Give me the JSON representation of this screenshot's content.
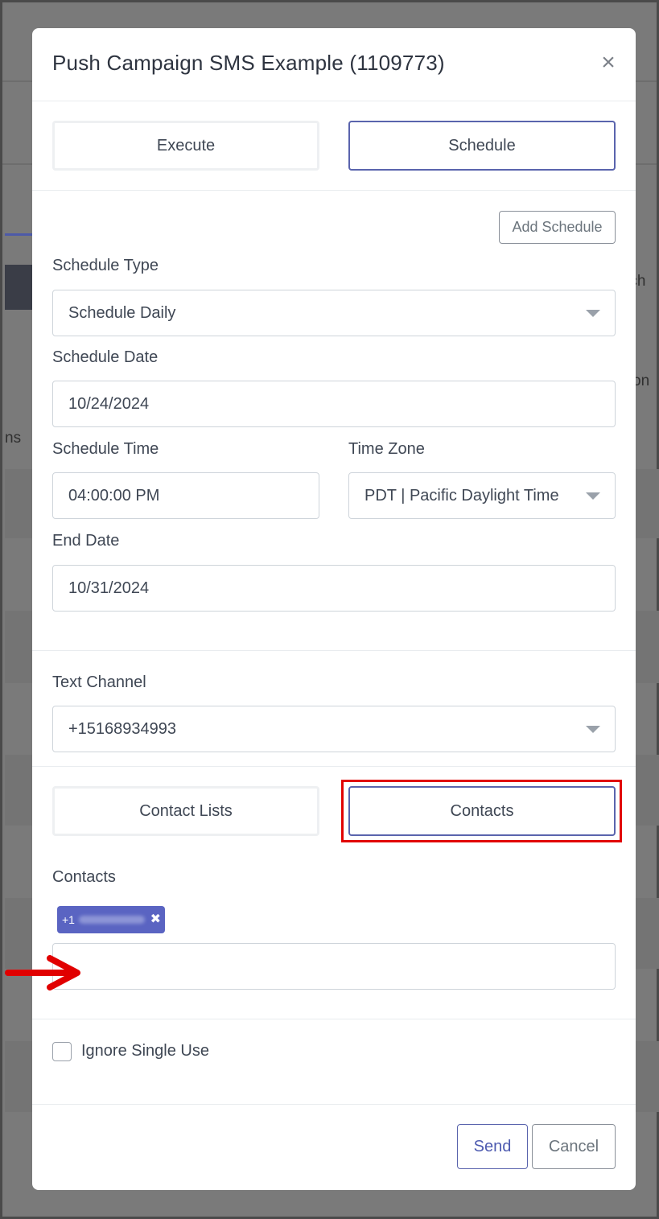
{
  "background": {
    "fragments": [
      "rch",
      "on",
      "ns"
    ]
  },
  "modal": {
    "title": "Push Campaign SMS Example (1109773)",
    "close_label": "×",
    "mode_tabs": [
      {
        "label": "Execute",
        "active": false
      },
      {
        "label": "Schedule",
        "active": true
      }
    ],
    "add_schedule_label": "Add Schedule",
    "schedule_type": {
      "label": "Schedule Type",
      "value": "Schedule Daily"
    },
    "schedule_date": {
      "label": "Schedule Date",
      "value": "10/24/2024"
    },
    "schedule_time": {
      "label": "Schedule Time",
      "value": "04:00:00 PM"
    },
    "time_zone": {
      "label": "Time Zone",
      "value": "PDT | Pacific Daylight Time"
    },
    "end_date": {
      "label": "End Date",
      "value": "10/31/2024"
    },
    "text_channel": {
      "label": "Text Channel",
      "value": "+15168934993"
    },
    "recipient_tabs": [
      {
        "label": "Contact Lists",
        "active": false
      },
      {
        "label": "Contacts",
        "active": true
      }
    ],
    "contacts": {
      "label": "Contacts",
      "tag_prefix": "+1",
      "tag_remove": "✖",
      "input_value": ""
    },
    "ignore_single_use": {
      "label": "Ignore Single Use",
      "checked": false
    },
    "send_label": "Send",
    "cancel_label": "Cancel"
  },
  "annotation_colors": {
    "highlight": "#e10000",
    "accent": "#5a64ad"
  }
}
